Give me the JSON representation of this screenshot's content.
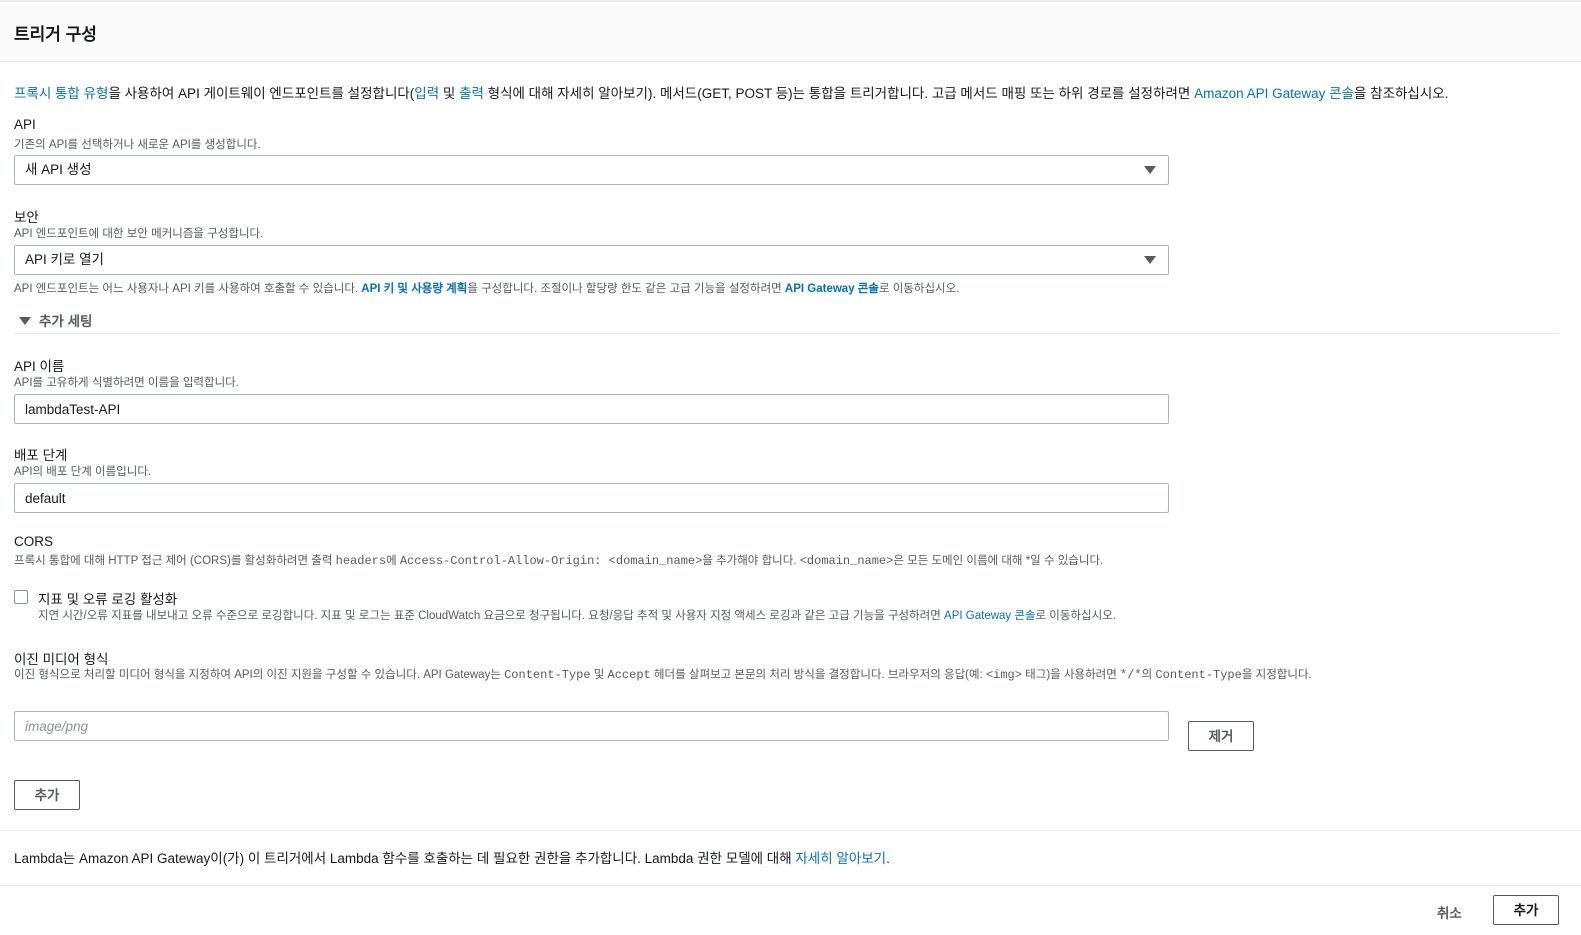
{
  "header": {
    "title": "트리거 구성"
  },
  "intro": {
    "link_proxy": "프록시 통합 유형",
    "t1": "을 사용하여 API 게이트웨이 엔드포인트를 설정합니다(",
    "link_input": "입력",
    "t2": " 및 ",
    "link_output": "출력",
    "t3": " 형식에 대해 자세히 알아보기). 메서드(GET, POST 등)는 통합을 트리거합니다. 고급 메서드 매핑 또는 하위 경로를 설정하려면 ",
    "link_console": "Amazon API Gateway 콘솔",
    "t4": "을 참조하십시오."
  },
  "api": {
    "label": "API",
    "desc": "기존의 API를 선택하거나 새로운 API를 생성합니다.",
    "value": "새 API 생성"
  },
  "security": {
    "label": "보안",
    "desc": "API 엔드포인트에 대한 보안 메커니즘을 구성합니다.",
    "value": "API 키로 열기",
    "help_t1": "API 엔드포인트는 어느 사용자나 API 키를 사용하여 호출할 수 있습니다. ",
    "help_link1": "API 키 및 사용량 계획",
    "help_t2": "을 구성합니다. 조절이나 할당량 한도 같은 고급 기능을 설정하려면 ",
    "help_link2": "API Gateway 콘솔",
    "help_t3": "로 이동하십시오."
  },
  "additional": {
    "label": "추가 세팅"
  },
  "api_name": {
    "label": "API 이름",
    "desc": "API를 고유하게 식별하려면 이름을 입력합니다.",
    "value": "lambdaTest-API"
  },
  "stage": {
    "label": "배포 단계",
    "desc": "API의 배포 단계 이름입니다.",
    "value": "default"
  },
  "cors": {
    "label": "CORS",
    "d1": "프록시 통합에 대해 HTTP 접근 제어 (CORS)를 활성화하려면 출력 ",
    "c1": "headers",
    "d2": "에 ",
    "c2": "Access-Control-Allow-Origin: <domain_name>",
    "d3": "을 추가해야 합니다. ",
    "c3": "<domain_name>",
    "d4": "은 모든 도메인 이름에 대해 *일 수 있습니다."
  },
  "logging": {
    "label": "지표 및 오류 로깅 활성화",
    "d1": "지연 시간/오류 지표를 내보내고 오류 수준으로 로깅합니다. 지표 및 로그는 표준 CloudWatch 요금으로 청구됩니다. 요청/응답 추적 및 사용자 지정 액세스 로깅과 같은 고급 기능을 구성하려면 ",
    "link": "API Gateway 콘솔",
    "d2": "로 이동하십시오.",
    "checked": false
  },
  "binary": {
    "label": "이진 미디어 형식",
    "d1": "이진 형식으로 처리할 미디어 형식을 지정하여 API의 이진 지원을 구성할 수 있습니다. API Gateway는 ",
    "c1": "Content-Type",
    "d2": " 및 ",
    "c2": "Accept",
    "d3": " 헤더를 살펴보고 본문의 처리 방식을 결정합니다. 브라우저의 응답(예: ",
    "c3": "<img>",
    "d4": " 태그)을 사용하려면 ",
    "c4": "*/*",
    "d5": "의 ",
    "c5": "Content-Type",
    "d6": "을 지정합니다.",
    "placeholder": "image/png",
    "remove_label": "제거",
    "add_label": "추가"
  },
  "footer": {
    "t1": "Lambda는 Amazon API Gateway이(가) 이 트리거에서 Lambda 함수를 호출하는 데 필요한 권한을 추가합니다. Lambda 권한 모델에 대해 ",
    "link": "자세히 알아보기",
    "t2": "."
  },
  "actions": {
    "cancel": "취소",
    "add": "추가"
  }
}
